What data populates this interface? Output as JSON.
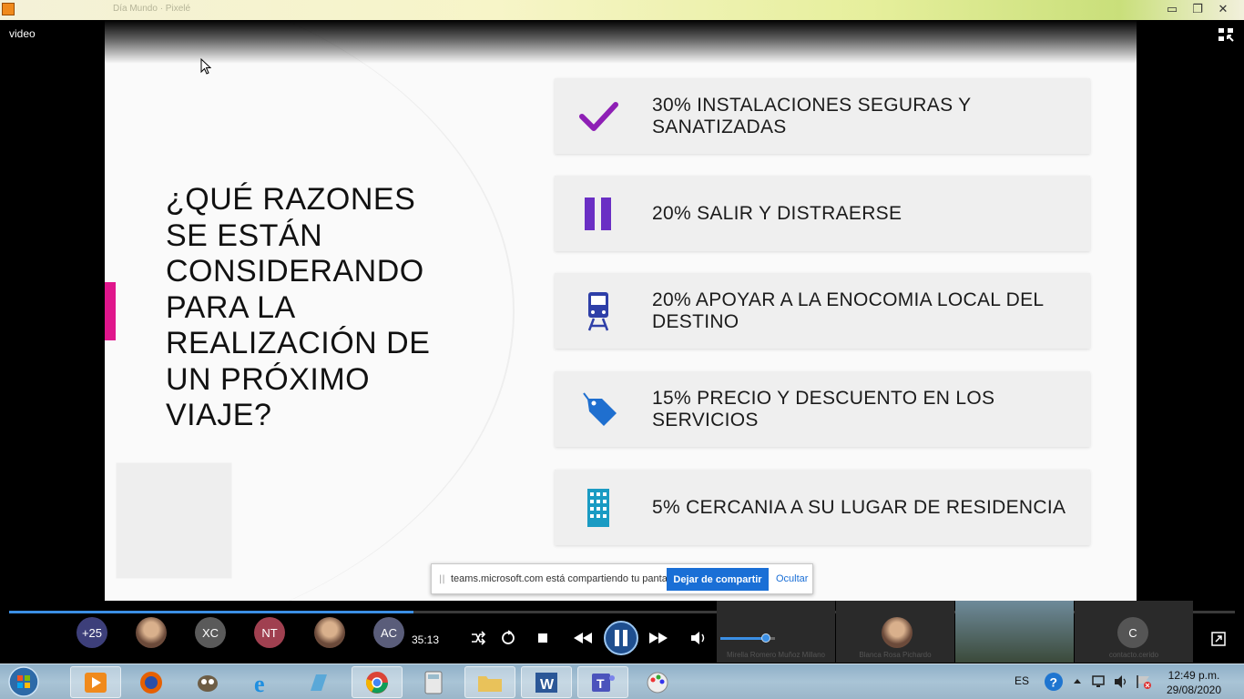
{
  "window": {
    "title_faded": "Día Mundo · Pixelé",
    "video_label": "video",
    "buttons": {
      "minimize": "▭",
      "restore": "❐",
      "close": "✕"
    }
  },
  "slide": {
    "question": "¿QUÉ RAZONES SE ESTÁN CONSIDERANDO PARA LA REALIZACIÓN DE UN PRÓXIMO VIAJE?",
    "accent_pink": "#e0168c",
    "items": [
      {
        "text": "30% INSTALACIONES SEGURAS Y SANATIZADAS",
        "icon": "checkmark-icon",
        "color": "#8e1fb5"
      },
      {
        "text": "20% SALIR Y DISTRAERSE",
        "icon": "pause-icon",
        "color": "#6a2fc4"
      },
      {
        "text": "20% APOYAR A LA ENOCOMIA LOCAL DEL DESTINO",
        "icon": "train-icon",
        "color": "#2e3fa8"
      },
      {
        "text": "15% PRECIO Y DESCUENTO EN LOS SERVICIOS",
        "icon": "tag-icon",
        "color": "#1f6fcf"
      },
      {
        "text": "5%  CERCANIA A SU LUGAR DE RESIDENCIA",
        "icon": "building-icon",
        "color": "#1a9bc3"
      }
    ]
  },
  "share_banner": {
    "grip": "||",
    "message": "teams.microsoft.com está compartiendo tu pantalla.",
    "stop_label": "Dejar de compartir",
    "hide_label": "Ocultar"
  },
  "player": {
    "progress": 0.33,
    "time": "35:13",
    "volume": 0.85
  },
  "participants": {
    "more_count": "+25",
    "initials": [
      "XC",
      "NT",
      "AC",
      "C"
    ],
    "tile_names": [
      "Mirella Romero Muñoz Millano",
      "Blanca Rosa Pichardo",
      "contacto.cerido"
    ]
  },
  "taskbar": {
    "language": "ES",
    "time": "12:49 p.m.",
    "date": "29/08/2020"
  }
}
